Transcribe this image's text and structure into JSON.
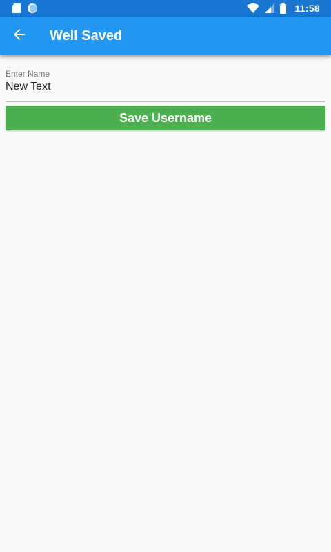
{
  "status_bar": {
    "time": "11:58",
    "icons": [
      "sd-card-icon",
      "sync-icon",
      "wifi-icon",
      "signal-icon",
      "battery-icon"
    ]
  },
  "app_bar": {
    "title": "Well Saved",
    "back_icon": "arrow-back-icon",
    "background_color": "#2196f3"
  },
  "form": {
    "name_field": {
      "label": "Enter Name",
      "value": "New Text"
    },
    "save_button": {
      "label": "Save Username",
      "color": "#4caf50"
    }
  },
  "colors": {
    "status_bar": "#1976d2",
    "background": "#fafafa"
  }
}
